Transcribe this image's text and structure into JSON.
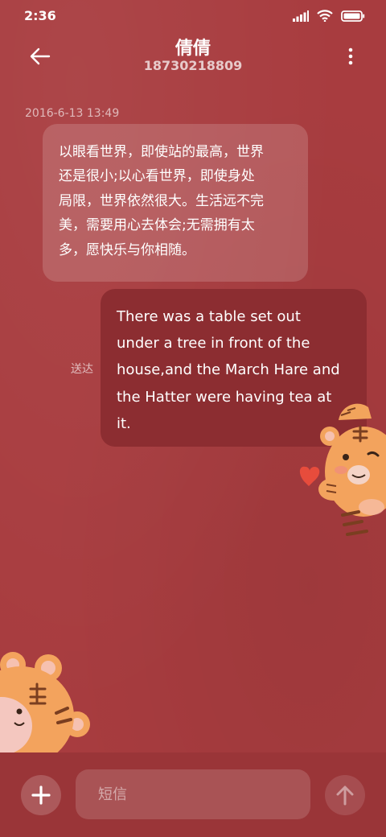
{
  "status_bar": {
    "time": "2:36",
    "icons": [
      "signal-icon",
      "wifi-icon",
      "battery-icon"
    ]
  },
  "header": {
    "contact_name": "倩倩",
    "contact_number": "18730218809",
    "back_icon": "arrow-left-icon",
    "more_icon": "more-vertical-icon"
  },
  "messages": [
    {
      "direction": "incoming",
      "timestamp": "2016-6-13 13:49",
      "lines": [
        "以眼看世界，即使站的最高，世界",
        "还是很小;以心看世界，即使身处",
        "局限，世界依然很大。生活远不完",
        "美，需要用心去体会;无需拥有太",
        "多，愿快乐与你相随。"
      ]
    },
    {
      "direction": "outgoing",
      "status": "送达",
      "lines": [
        "There was a table set out",
        "under a tree in front of the",
        "house,and the March Hare and",
        "the Hatter were having tea at",
        "it."
      ]
    }
  ],
  "composer": {
    "placeholder": "短信",
    "add_icon": "plus-icon",
    "send_icon": "arrow-up-icon"
  },
  "colors": {
    "background": "#a83c3f",
    "outgoing_bubble": "#8c2d31",
    "input_bar": "#9a3538"
  },
  "stickers": [
    "tiger-sticker-right",
    "tiger-sticker-left"
  ]
}
